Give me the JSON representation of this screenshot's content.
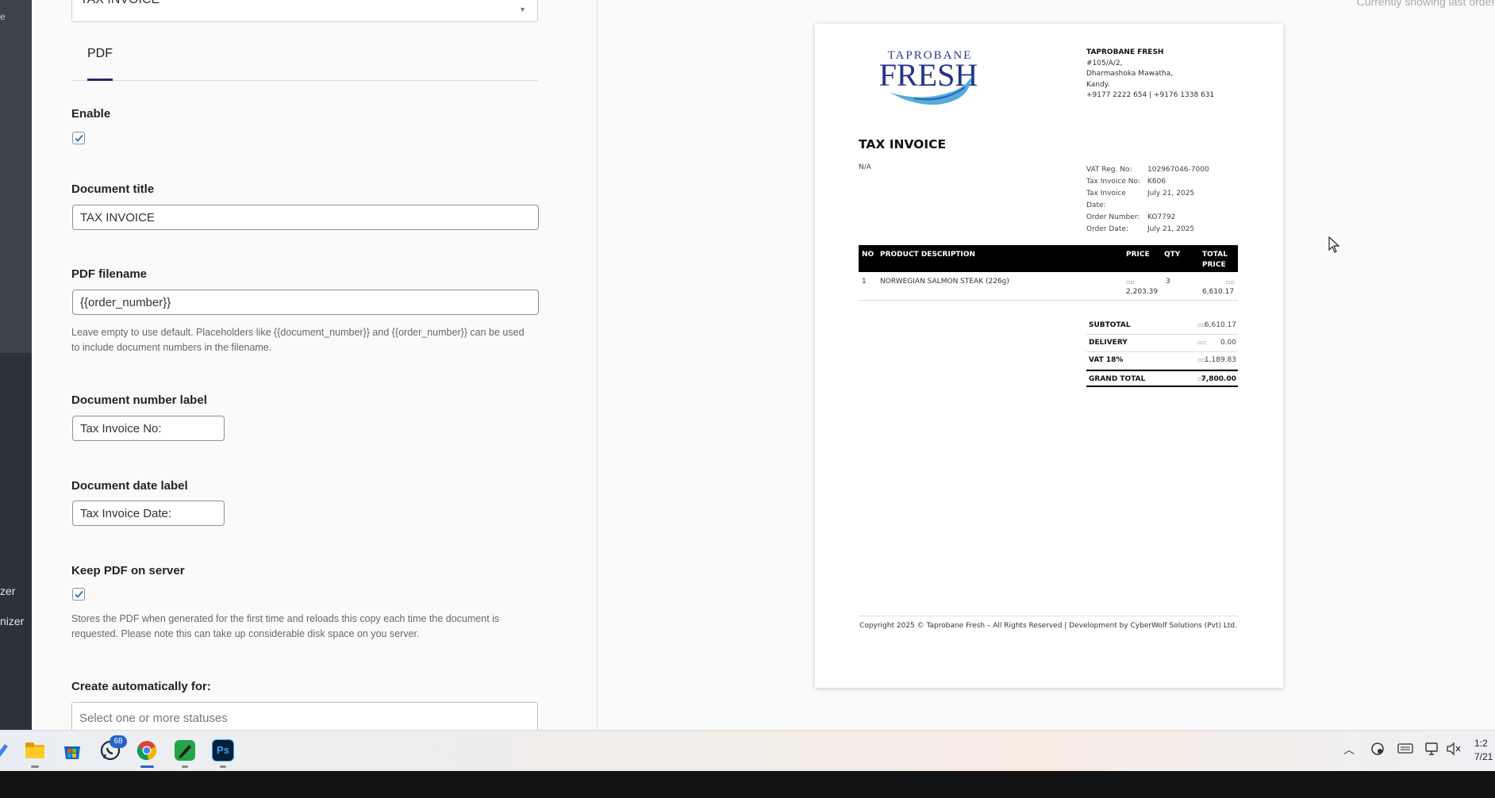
{
  "sidebar": {
    "top_mark": "e",
    "items": [
      "zer",
      "nizer"
    ]
  },
  "settings": {
    "document_type_select": "TAX INVOICE",
    "tabs": [
      {
        "label": "PDF"
      }
    ],
    "enable": {
      "label": "Enable",
      "checked": true
    },
    "document_title": {
      "label": "Document title",
      "value": "TAX INVOICE"
    },
    "pdf_filename": {
      "label": "PDF filename",
      "value": "{{order_number}}",
      "help_line1": "Leave empty to use default. Placeholders like {{document_number}} and {{order_number}} can be used",
      "help_line2": "to include document numbers in the filename."
    },
    "document_number_label": {
      "label": "Document number label",
      "value": "Tax Invoice No:"
    },
    "document_date_label": {
      "label": "Document date label",
      "value": "Tax Invoice Date:"
    },
    "keep_pdf": {
      "label": "Keep PDF on server",
      "checked": true,
      "help_line1": "Stores the PDF when generated for the first time and reloads this copy each time the document is",
      "help_line2": "requested. Please note this can take up considerable disk space on you server."
    },
    "create_automatically": {
      "label": "Create automatically for:",
      "placeholder": "Select one or more statuses"
    }
  },
  "preview": {
    "note": "Currently showing last order"
  },
  "invoice": {
    "logo_top": "TAPROBANE",
    "logo_main": "FRESH",
    "company_name": "TAPROBANE FRESH",
    "address_lines": [
      "#105/A/2,",
      "Dharmashoka Mawatha,",
      "Kandy.",
      "+9177 2222 654 | +9176 1338 631"
    ],
    "title": "TAX INVOICE",
    "billing": "N/A",
    "meta": [
      {
        "k": "VAT Reg. No:",
        "v": "102967046-7000"
      },
      {
        "k": "Tax Invoice No:",
        "v": "K606"
      },
      {
        "k": "Tax Invoice Date:",
        "v": "July 21, 2025"
      },
      {
        "k": "Order Number:",
        "v": "KO7792"
      },
      {
        "k": "Order Date:",
        "v": "July 21, 2025"
      }
    ],
    "table_headers": {
      "no": "NO",
      "desc": "PRODUCT DESCRIPTION",
      "price": "PRICE",
      "qty": "QTY",
      "total_l1": "TOTAL",
      "total_l2": "PRICE"
    },
    "items": [
      {
        "no": "1",
        "desc": "NORWEGIAN SALMON STEAK (226g)",
        "price_cur": "▫▫",
        "price": "2,203.39",
        "qty": "3",
        "total_cur": "▫▫",
        "total": "6,610.17"
      }
    ],
    "totals": [
      {
        "k": "SUBTOTAL",
        "v": "6,610.17"
      },
      {
        "k": "DELIVERY",
        "v": "0.00"
      },
      {
        "k": "VAT 18%",
        "v": "1,189.83"
      },
      {
        "k": "GRAND TOTAL",
        "v": "7,800.00"
      }
    ],
    "currency_glyph": "▫▫",
    "copyright": "Copyright 2025 © Taprobane Fresh – All Rights Reserved | Development by CyberWolf Solutions (Pvt) Ltd."
  },
  "taskbar": {
    "whatsapp_badge": "68",
    "photoshop_label": "Ps",
    "clock_time": "1:2",
    "clock_date": "7/21"
  }
}
